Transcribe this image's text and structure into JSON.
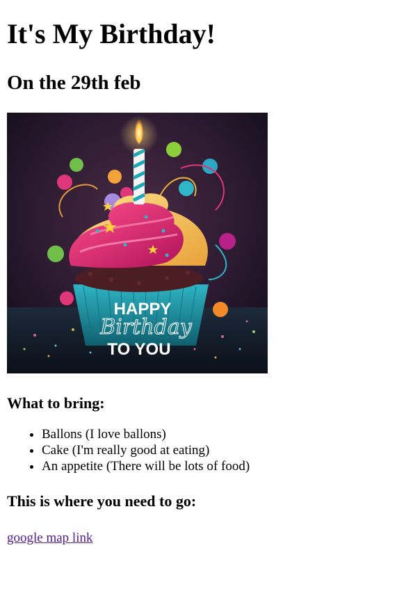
{
  "page": {
    "title": "It's My Birthday!",
    "subtitle": "On the 29th feb"
  },
  "image": {
    "text_line1": "HAPPY",
    "text_line2": "Birthday",
    "text_line3": "TO YOU"
  },
  "bring": {
    "heading": "What to bring:",
    "items": [
      "Ballons (I love ballons)",
      "Cake (I'm really good at eating)",
      "An appetite (There will be lots of food)"
    ]
  },
  "directions": {
    "heading": "This is where you need to go:",
    "link_text": "google map link"
  }
}
